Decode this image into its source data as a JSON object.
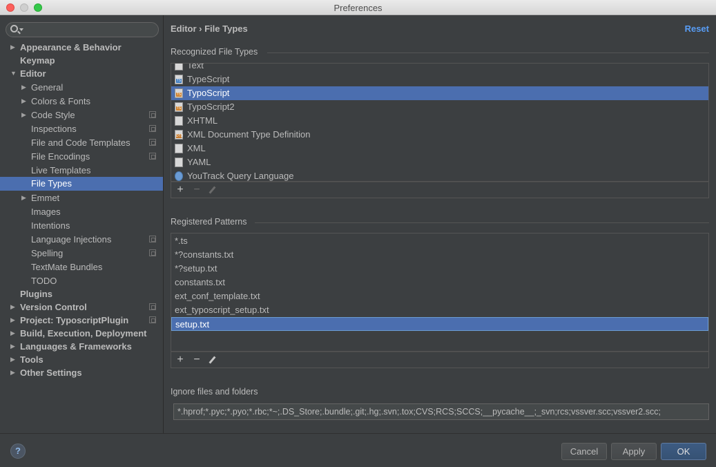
{
  "window": {
    "title": "Preferences"
  },
  "sidebar": {
    "search_placeholder": "",
    "items": [
      {
        "label": "Appearance & Behavior",
        "level": 0,
        "arrow": "collapsed",
        "bold": true,
        "project": false
      },
      {
        "label": "Keymap",
        "level": 0,
        "arrow": "none",
        "bold": true,
        "project": false
      },
      {
        "label": "Editor",
        "level": 0,
        "arrow": "expanded",
        "bold": true,
        "project": false
      },
      {
        "label": "General",
        "level": 1,
        "arrow": "collapsed",
        "bold": false,
        "project": false
      },
      {
        "label": "Colors & Fonts",
        "level": 1,
        "arrow": "collapsed",
        "bold": false,
        "project": false
      },
      {
        "label": "Code Style",
        "level": 1,
        "arrow": "collapsed",
        "bold": false,
        "project": true
      },
      {
        "label": "Inspections",
        "level": 1,
        "arrow": "none",
        "bold": false,
        "project": true
      },
      {
        "label": "File and Code Templates",
        "level": 1,
        "arrow": "none",
        "bold": false,
        "project": true
      },
      {
        "label": "File Encodings",
        "level": 1,
        "arrow": "none",
        "bold": false,
        "project": true
      },
      {
        "label": "Live Templates",
        "level": 1,
        "arrow": "none",
        "bold": false,
        "project": false
      },
      {
        "label": "File Types",
        "level": 1,
        "arrow": "none",
        "bold": false,
        "project": false,
        "selected": true
      },
      {
        "label": "Emmet",
        "level": 1,
        "arrow": "collapsed",
        "bold": false,
        "project": false
      },
      {
        "label": "Images",
        "level": 1,
        "arrow": "none",
        "bold": false,
        "project": false
      },
      {
        "label": "Intentions",
        "level": 1,
        "arrow": "none",
        "bold": false,
        "project": false
      },
      {
        "label": "Language Injections",
        "level": 1,
        "arrow": "none",
        "bold": false,
        "project": true
      },
      {
        "label": "Spelling",
        "level": 1,
        "arrow": "none",
        "bold": false,
        "project": true
      },
      {
        "label": "TextMate Bundles",
        "level": 1,
        "arrow": "none",
        "bold": false,
        "project": false
      },
      {
        "label": "TODO",
        "level": 1,
        "arrow": "none",
        "bold": false,
        "project": false
      },
      {
        "label": "Plugins",
        "level": 0,
        "arrow": "none",
        "bold": true,
        "project": false
      },
      {
        "label": "Version Control",
        "level": 0,
        "arrow": "collapsed",
        "bold": true,
        "project": true
      },
      {
        "label": "Project: TyposcriptPlugin",
        "level": 0,
        "arrow": "collapsed",
        "bold": true,
        "project": true
      },
      {
        "label": "Build, Execution, Deployment",
        "level": 0,
        "arrow": "collapsed",
        "bold": true,
        "project": false
      },
      {
        "label": "Languages & Frameworks",
        "level": 0,
        "arrow": "collapsed",
        "bold": true,
        "project": false
      },
      {
        "label": "Tools",
        "level": 0,
        "arrow": "collapsed",
        "bold": true,
        "project": false
      },
      {
        "label": "Other Settings",
        "level": 0,
        "arrow": "collapsed",
        "bold": true,
        "project": false
      }
    ]
  },
  "header": {
    "breadcrumb": "Editor › File Types",
    "reset_label": "Reset"
  },
  "recognized": {
    "title": "Recognized File Types",
    "items": [
      {
        "label": "Text",
        "icon": "text-file-icon",
        "tag": ""
      },
      {
        "label": "TypeScript",
        "icon": "typescript-file-icon",
        "tag": "TS"
      },
      {
        "label": "TypoScript",
        "icon": "typoscript-file-icon",
        "tag": "TS",
        "selected": true
      },
      {
        "label": "TypoScript2",
        "icon": "typoscript2-file-icon",
        "tag": "TS"
      },
      {
        "label": "XHTML",
        "icon": "xhtml-file-icon",
        "tag": ""
      },
      {
        "label": "XML Document Type Definition",
        "icon": "dtd-file-icon",
        "tag": "DTD"
      },
      {
        "label": "XML",
        "icon": "xml-file-icon",
        "tag": ""
      },
      {
        "label": "YAML",
        "icon": "yaml-file-icon",
        "tag": ""
      },
      {
        "label": "YouTrack Query Language",
        "icon": "youtrack-icon",
        "tag": ""
      }
    ]
  },
  "patterns": {
    "title": "Registered Patterns",
    "items": [
      {
        "label": "*.ts"
      },
      {
        "label": "*?constants.txt"
      },
      {
        "label": "*?setup.txt"
      },
      {
        "label": "constants.txt"
      },
      {
        "label": "ext_conf_template.txt"
      },
      {
        "label": "ext_typoscript_setup.txt"
      },
      {
        "label": "setup.txt",
        "selected": true
      }
    ]
  },
  "toolbar": {
    "add": "+",
    "remove": "−"
  },
  "ignore": {
    "title": "Ignore files and folders",
    "value": "*.hprof;*.pyc;*.pyo;*.rbc;*~;.DS_Store;.bundle;.git;.hg;.svn;.tox;CVS;RCS;SCCS;__pycache__;_svn;rcs;vssver.scc;vssver2.scc;"
  },
  "buttons": {
    "help": "?",
    "cancel": "Cancel",
    "apply": "Apply",
    "ok": "OK"
  },
  "colors": {
    "background": "#3c3f41",
    "selection": "#4b6eaf",
    "link": "#589df6",
    "text": "#bbbbbb"
  }
}
